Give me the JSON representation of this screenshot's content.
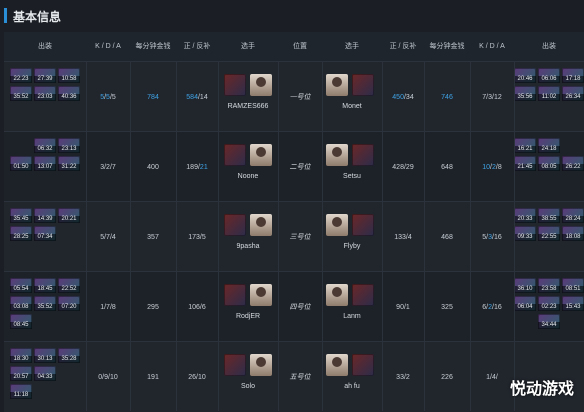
{
  "header": {
    "title": "基本信息"
  },
  "columns": [
    "出装",
    "K / D / A",
    "每分钟金钱",
    "正 / 反补",
    "选手",
    "位置",
    "选手",
    "正 / 反补",
    "每分钟金钱",
    "K / D / A",
    "出装"
  ],
  "rows": [
    {
      "left_items": [
        "22:23",
        "27:39",
        "10:58",
        "35:52",
        "23:03",
        "40:36"
      ],
      "left_kda": [
        "5",
        "/",
        "5",
        "/",
        "5"
      ],
      "left_gpm": "784",
      "left_lh": [
        "584",
        " / ",
        "14"
      ],
      "left_player": "RAMZES666",
      "position": "一号位",
      "right_player": "Monet",
      "right_lh": [
        "450",
        " / ",
        "34"
      ],
      "right_gpm": "746",
      "right_kda": [
        "7",
        "/",
        "3",
        "/",
        "12"
      ],
      "right_items": [
        "20:46",
        "06:06",
        "17:18",
        "35:56",
        "11:02",
        "26:34"
      ]
    },
    {
      "left_items": [
        "",
        "06:32",
        "23:13",
        "01:50",
        "13:07",
        "31:22"
      ],
      "left_kda": [
        "3",
        "/",
        "2",
        "/",
        "7"
      ],
      "left_gpm": "400",
      "left_lh": [
        "189",
        " / ",
        "21"
      ],
      "left_player": "Noone",
      "position": "二号位",
      "right_player": "Setsu",
      "right_lh": [
        "428",
        " / ",
        "29"
      ],
      "right_gpm": "648",
      "right_kda": [
        "10",
        "/",
        "2",
        "/",
        "8"
      ],
      "right_items": [
        "16:21",
        "24:18",
        "",
        "21:45",
        "08:05",
        "26:22"
      ]
    },
    {
      "left_items": [
        "35:45",
        "14:39",
        "20:21",
        "28:25",
        "07:34",
        ""
      ],
      "left_kda": [
        "5",
        "/",
        "7",
        "/",
        "4"
      ],
      "left_gpm": "357",
      "left_lh": [
        "173",
        " / ",
        "5"
      ],
      "left_player": "9pasha",
      "position": "三号位",
      "right_player": "Flyby",
      "right_lh": [
        "133",
        " / ",
        "4"
      ],
      "right_gpm": "468",
      "right_kda": [
        "5",
        "/",
        "3",
        "/",
        "16"
      ],
      "right_items": [
        "20:33",
        "38:55",
        "28:24",
        "09:33",
        "22:55",
        "18:08"
      ]
    },
    {
      "left_items": [
        "05:54",
        "18:45",
        "22:52",
        "03:08",
        "35:52",
        "07:20"
      ],
      "left_kda": [
        "1",
        "/",
        "7",
        "/",
        "8"
      ],
      "left_gpm": "295",
      "left_lh": [
        "106",
        " / ",
        "6"
      ],
      "left_player": "RodjER",
      "position": "四号位",
      "right_player": "Lanm",
      "right_lh": [
        "90",
        " / ",
        "1"
      ],
      "right_gpm": "325",
      "right_kda": [
        "6",
        "/",
        "2",
        "/",
        "16"
      ],
      "right_items": [
        "36:10",
        "23:58",
        "08:51",
        "06:04",
        "02:23",
        "15:43"
      ],
      "left_extra": "08:45",
      "right_extra": "34:44"
    },
    {
      "left_items": [
        "18:30",
        "30:13",
        "35:28",
        "20:57",
        "04:33",
        ""
      ],
      "left_kda": [
        "0",
        "/",
        "9",
        "/",
        "10"
      ],
      "left_gpm": "191",
      "left_lh": [
        "26",
        " / ",
        "10"
      ],
      "left_player": "Solo",
      "position": "五号位",
      "right_player": "ah fu",
      "right_lh": [
        "33",
        " / ",
        "2"
      ],
      "right_gpm": "226",
      "right_kda": [
        "1",
        "/",
        "4",
        "/",
        ""
      ],
      "right_items": [
        "",
        "",
        "",
        "",
        "",
        ""
      ],
      "left_extra": "11:18"
    }
  ],
  "watermark": "悦动游戏"
}
